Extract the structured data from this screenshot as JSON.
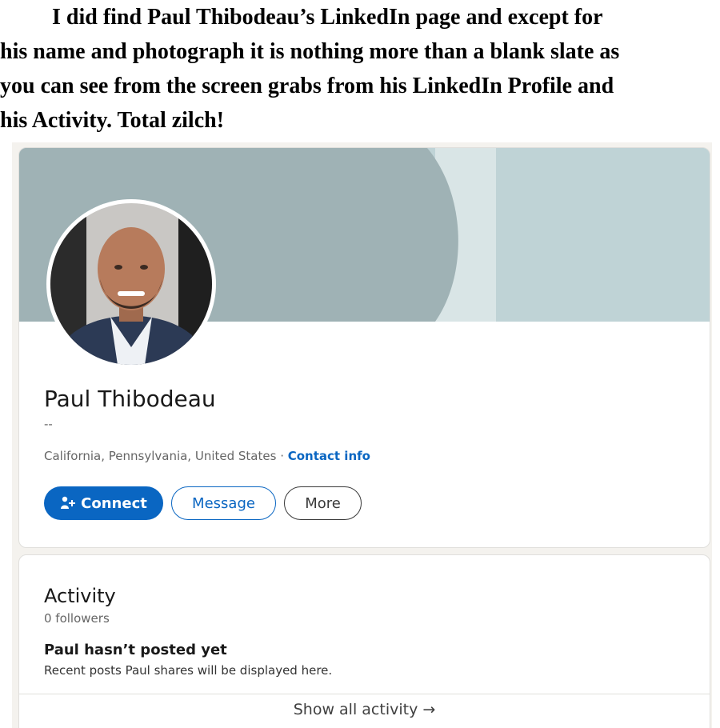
{
  "caption": {
    "lines": [
      "I did find Paul Thibodeau’s LinkedIn page and except for",
      "his name and photograph it is nothing more than a blank slate as",
      "you can see from the screen grabs from his LinkedIn Profile and",
      "his Activity.  Total zilch!"
    ]
  },
  "profile": {
    "name": "Paul Thibodeau",
    "headline": "--",
    "location": "California, Pennsylvania, United States",
    "separator": " · ",
    "contact_info": "Contact info",
    "buttons": {
      "connect": "Connect",
      "message": "Message",
      "more": "More"
    }
  },
  "activity": {
    "title": "Activity",
    "followers": "0 followers",
    "empty_title": "Paul hasn’t posted yet",
    "empty_desc": "Recent posts Paul shares will be displayed here.",
    "show_all": "Show all activity",
    "show_all_arrow": "→"
  },
  "colors": {
    "accent": "#0a66c2",
    "cover_dark": "#9fb2b5",
    "cover_light": "#bfd3d6",
    "page_bg": "#f4f2ee"
  }
}
